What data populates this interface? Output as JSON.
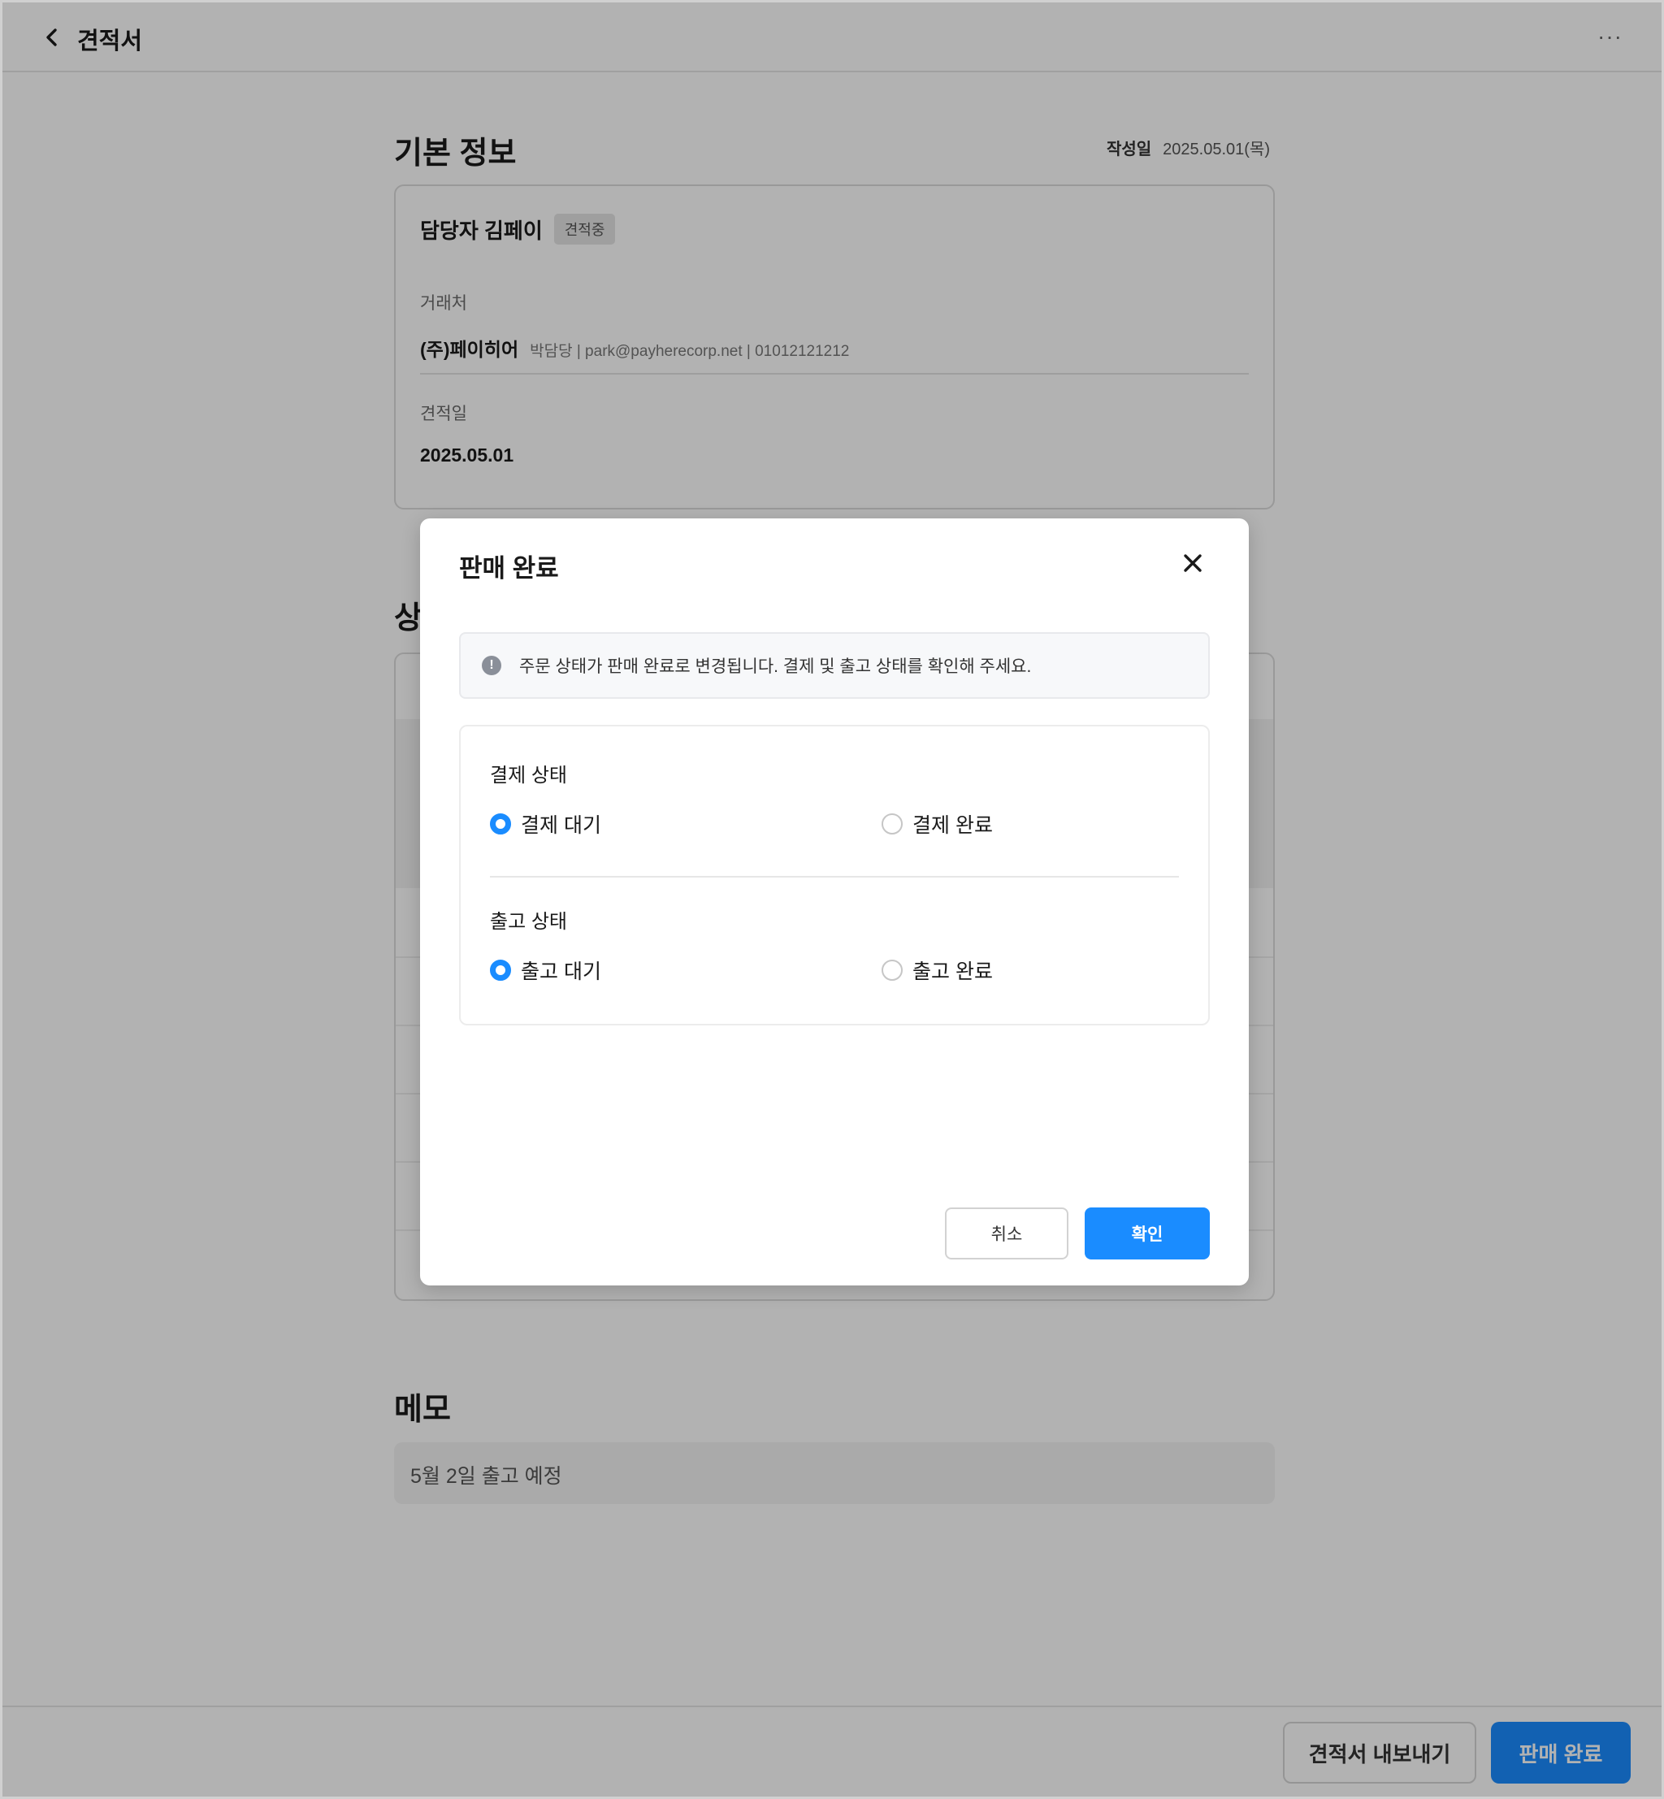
{
  "header": {
    "title": "견적서",
    "more_label": "···"
  },
  "basic_info": {
    "title": "기본 정보",
    "created_label": "작성일",
    "created_value": "2025.05.01(목)",
    "manager": "담당자 김페이",
    "status_badge": "견적중",
    "client_label": "거래처",
    "client_name": "(주)페이히어",
    "client_meta": "박담당 | park@payherecorp.net | 01012121212",
    "quote_date_label": "견적일",
    "quote_date_value": "2025.05.01"
  },
  "products": {
    "title_partial": "상"
  },
  "memo": {
    "title": "메모",
    "value": "5월 2일 출고 예정"
  },
  "bottom_bar": {
    "export_label": "견적서 내보내기",
    "complete_label": "판매 완료"
  },
  "modal": {
    "title": "판매 완료",
    "notice": "주문 상태가 판매 완료로 변경됩니다. 결제 및 출고 상태를 확인해 주세요.",
    "payment": {
      "label": "결제 상태",
      "options": [
        {
          "label": "결제 대기",
          "selected": true
        },
        {
          "label": "결제 완료",
          "selected": false
        }
      ]
    },
    "shipping": {
      "label": "출고 상태",
      "options": [
        {
          "label": "출고 대기",
          "selected": true
        },
        {
          "label": "출고 완료",
          "selected": false
        }
      ]
    },
    "cancel_label": "취소",
    "confirm_label": "확인"
  },
  "colors": {
    "accent": "#1a8cff",
    "overlay": "rgba(0,0,0,0.30)"
  }
}
